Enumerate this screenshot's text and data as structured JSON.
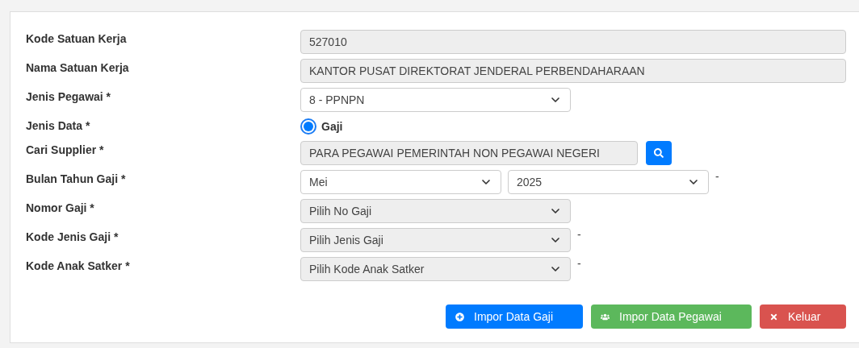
{
  "form": {
    "fields": [
      {
        "label": "Kode Satuan Kerja",
        "kind": "text",
        "value": "527010",
        "disabled": true
      },
      {
        "label": "Nama Satuan Kerja",
        "kind": "text",
        "value": "KANTOR PUSAT DIREKTORAT JENDERAL PERBENDAHARAAN",
        "disabled": true
      },
      {
        "label": "Jenis Pegawai *",
        "kind": "select",
        "value": "8 - PPNPN",
        "disabled": false
      },
      {
        "label": "Jenis Data *",
        "kind": "radio",
        "options": [
          {
            "label": "Gaji",
            "selected": true
          }
        ]
      },
      {
        "label": "Cari Supplier *",
        "kind": "search",
        "value": "PARA PEGAWAI PEMERINTAH NON PEGAWAI NEGERI",
        "disabled": true
      },
      {
        "label": "Bulan Tahun Gaji *",
        "kind": "month-year",
        "month": "Mei",
        "year": "2025",
        "suffix": "-"
      },
      {
        "label": "Nomor Gaji *",
        "kind": "select",
        "value": "Pilih No Gaji",
        "disabled": true
      },
      {
        "label": "Kode Jenis Gaji *",
        "kind": "select",
        "value": "Pilih Jenis Gaji",
        "disabled": true,
        "suffix": "-"
      },
      {
        "label": "Kode Anak Satker *",
        "kind": "select",
        "value": "Pilih Kode Anak Satker",
        "disabled": true,
        "suffix": "-"
      }
    ]
  },
  "buttons": [
    {
      "label": "Impor Data Gaji",
      "kind": "import-salary"
    },
    {
      "label": "Impor Data Pegawai",
      "kind": "import-employee"
    },
    {
      "label": "Keluar",
      "kind": "exit"
    }
  ]
}
